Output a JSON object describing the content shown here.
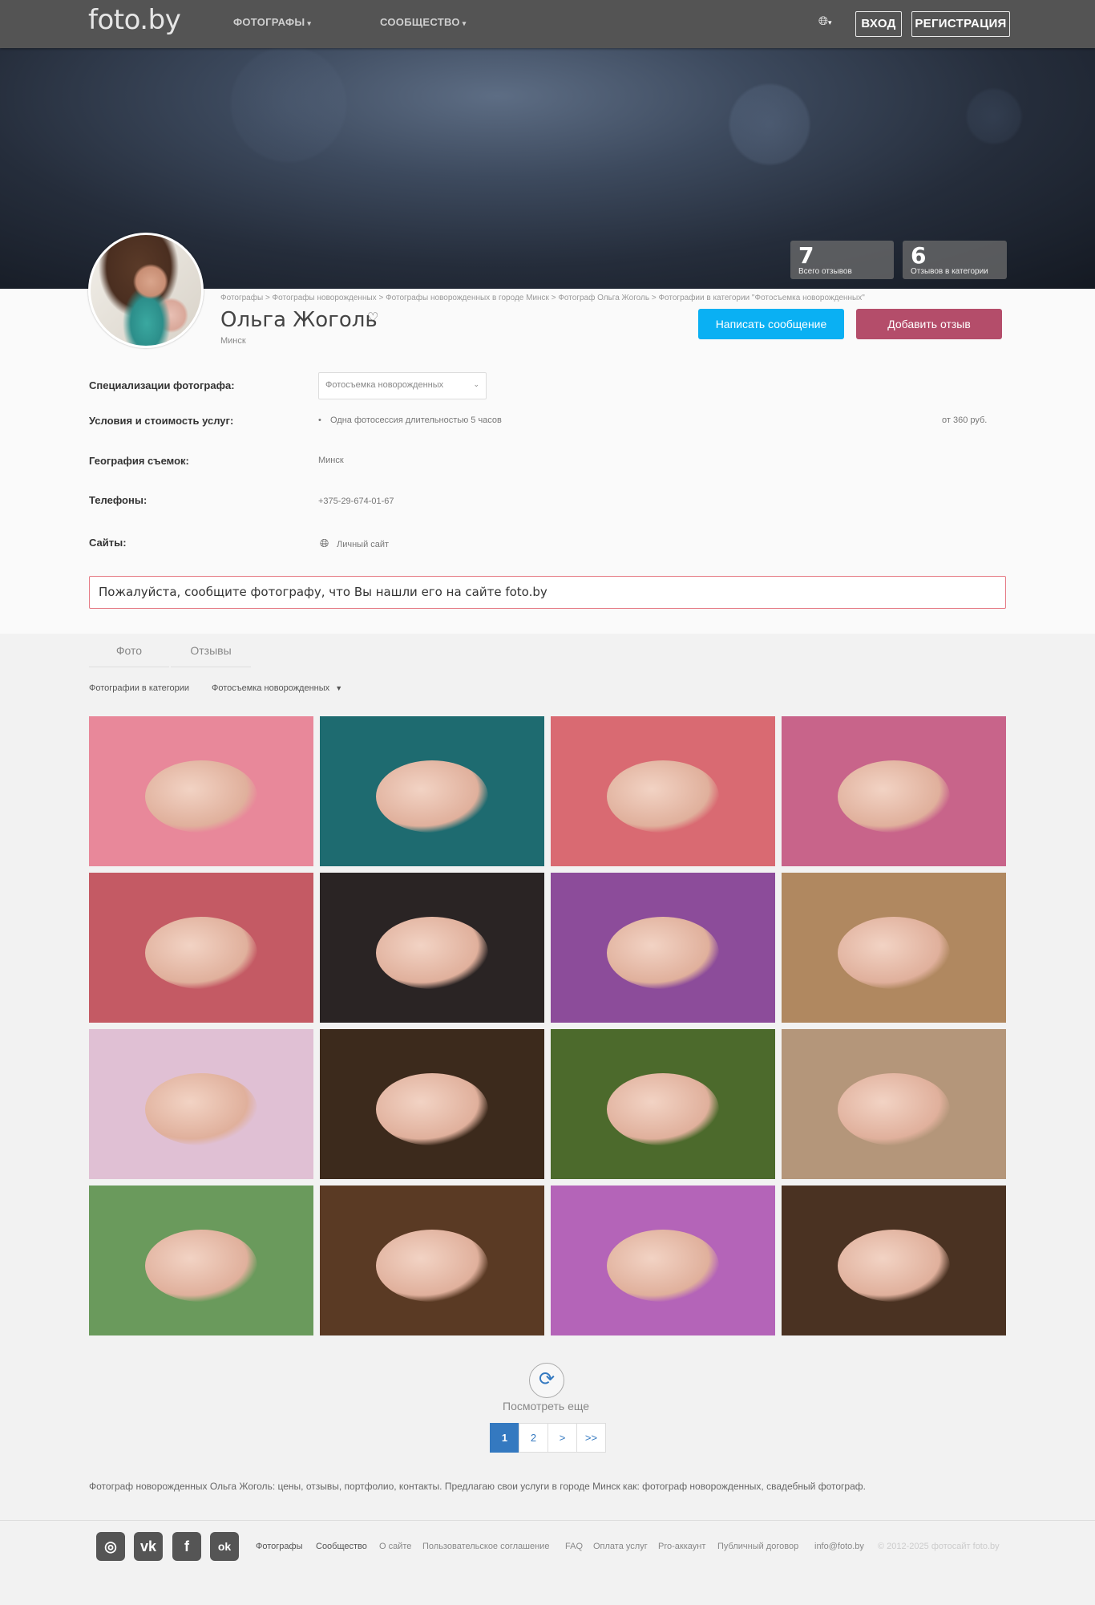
{
  "header": {
    "logo": "foto.by",
    "nav": [
      {
        "label": "ФОТОГРАФЫ"
      },
      {
        "label": "СООБЩЕСТВО"
      }
    ],
    "login": "ВХОД",
    "register": "РЕГИСТРАЦИЯ"
  },
  "stats": [
    {
      "num": "7",
      "label": "Всего отзывов"
    },
    {
      "num": "6",
      "label": "Отзывов в категории"
    }
  ],
  "breadcrumb": "Фотографы > Фотографы новорожденных > Фотографы новорожденных в городе Минск > Фотограф Ольга Жоголь > Фотографии в категории \"Фотосъемка новорожденных\"",
  "profile": {
    "name": "Ольга Жоголь",
    "city": "Минск",
    "message_button": "Написать сообщение",
    "review_button": "Добавить отзыв"
  },
  "details": {
    "spec_label": "Специализации фотографа:",
    "spec_value": "Фотосъемка новорожденных",
    "terms_label": "Условия и стоимость услуг:",
    "terms_item": "Одна фотосессия длительностью 5 часов",
    "terms_price": "от 360 руб.",
    "geo_label": "География съемок:",
    "geo_value": "Минск",
    "phones_label": "Телефоны:",
    "phone": "+375-29-674-01-67",
    "sites_label": "Сайты:",
    "site": "Личный сайт"
  },
  "notice": "Пожалуйста, сообщите фотографу, что Вы нашли его на сайте foto.by",
  "tabs": [
    {
      "label": "Фото"
    },
    {
      "label": "Отзывы"
    }
  ],
  "category_filter": {
    "label": "Фотографии в категории",
    "value": "Фотосъемка новорожденных"
  },
  "more": "Посмотреть еще",
  "pagination": [
    "1",
    "2",
    ">",
    ">>"
  ],
  "seo_text": "Фотограф новорожденных Ольга Жоголь: цены, отзывы, портфолио, контакты. Предлагаю свои услуги в городе Минск как: фотограф новорожденных, свадебный фотограф.",
  "footer": {
    "social": [
      {
        "icon": "instagram-icon",
        "glyph": "◎"
      },
      {
        "icon": "vk-icon",
        "glyph": "vk"
      },
      {
        "icon": "facebook-icon",
        "glyph": "f"
      },
      {
        "icon": "odnoklassniki-icon",
        "glyph": "ok"
      }
    ],
    "links": [
      "Фотографы",
      "Сообщество",
      "О сайте",
      "Пользовательское соглашение",
      "FAQ",
      "Оплата услуг",
      "Pro-аккаунт",
      "Публичный договор",
      "info@foto.by"
    ],
    "copyright": "© 2012-2025 фотосайт foto.by"
  },
  "photos": [
    {
      "bg": "#e8889a"
    },
    {
      "bg": "#1e6b70"
    },
    {
      "bg": "#d96a72"
    },
    {
      "bg": "#c8648a"
    },
    {
      "bg": "#c45a64"
    },
    {
      "bg": "#2a2424"
    },
    {
      "bg": "#8c4c9a"
    },
    {
      "bg": "#b08860"
    },
    {
      "bg": "#e0c0d4"
    },
    {
      "bg": "#3c2a1c"
    },
    {
      "bg": "#4c6a2c"
    },
    {
      "bg": "#b4967a"
    },
    {
      "bg": "#6a9a5c"
    },
    {
      "bg": "#5a3a24"
    },
    {
      "bg": "#b464b8"
    },
    {
      "bg": "#4a3222"
    }
  ]
}
